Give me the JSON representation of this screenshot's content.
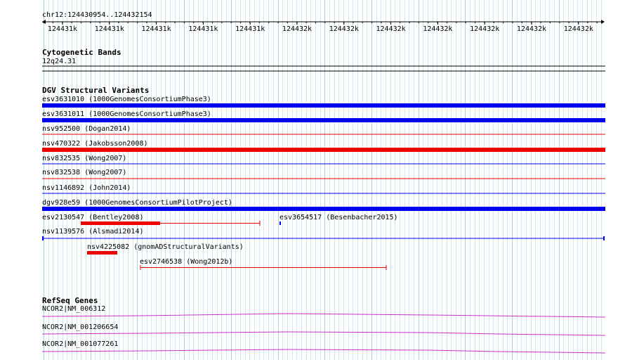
{
  "ruler": {
    "region": "chr12:124430954..124432154",
    "ticks": [
      "124431k",
      "124431k",
      "124431k",
      "124431k",
      "124431k",
      "124432k",
      "124432k",
      "124432k",
      "124432k",
      "124432k",
      "124432k",
      "124432k"
    ]
  },
  "cytoband": {
    "title": "Cytogenetic Bands",
    "band": "12q24.31"
  },
  "dgv": {
    "title": "DGV Structural Variants",
    "features": [
      {
        "label": "esv3631010 (1000GenomesConsortiumPhase3)",
        "color": "#0000ee"
      },
      {
        "label": "esv3631011 (1000GenomesConsortiumPhase3)",
        "color": "#0000ee"
      },
      {
        "label": "nsv952500 (Dogan2014)",
        "color": "#ee0000"
      },
      {
        "label": "nsv470322 (Jakobsson2008)",
        "color": "#ee0000"
      },
      {
        "label": "nsv832535 (Wong2007)",
        "color": "#0000ee"
      },
      {
        "label": "nsv832538 (Wong2007)",
        "color": "#ee0000"
      },
      {
        "label": "nsv1146892 (John2014)",
        "color": "#0000ee"
      },
      {
        "label": "dgv928e59 (1000GenomesConsortiumPilotProject)",
        "color": "#0000ee"
      },
      {
        "label": "esv2130547 (Bentley2008)",
        "color": "#ee0000"
      },
      {
        "label": "esv3654517 (Besenbacher2015)",
        "color": "#0000ee"
      },
      {
        "label": "nsv1139576 (Alsmadi2014)",
        "color": "#0000ee"
      },
      {
        "label": "nsv4225082 (gnomADStructuralVariants)",
        "color": "#ee0000"
      },
      {
        "label": "esv2746538 (Wong2012b)",
        "color": "#ee0000"
      }
    ]
  },
  "refseq": {
    "title": "RefSeq Genes",
    "color": "#cc33cc",
    "genes": [
      {
        "label": "NCOR2|NM_006312"
      },
      {
        "label": "NCOR2|NM_001206654"
      },
      {
        "label": "NCOR2|NM_001077261"
      }
    ]
  }
}
